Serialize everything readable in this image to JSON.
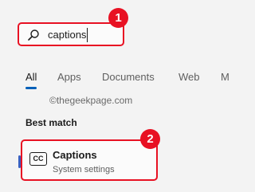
{
  "search": {
    "value": "captions"
  },
  "callouts": {
    "first": "1",
    "second": "2"
  },
  "tabs": [
    {
      "label": "All",
      "active": true
    },
    {
      "label": "Apps"
    },
    {
      "label": "Documents"
    },
    {
      "label": "Web"
    },
    {
      "label": "M"
    }
  ],
  "watermark": "©thegeekpage.com",
  "section": {
    "title": "Best match"
  },
  "result": {
    "icon_text": "CC",
    "title": "Captions",
    "subtitle": "System settings"
  },
  "colors": {
    "highlight": "#e81123",
    "accent": "#005fb8",
    "background": "#f3f3f3"
  }
}
